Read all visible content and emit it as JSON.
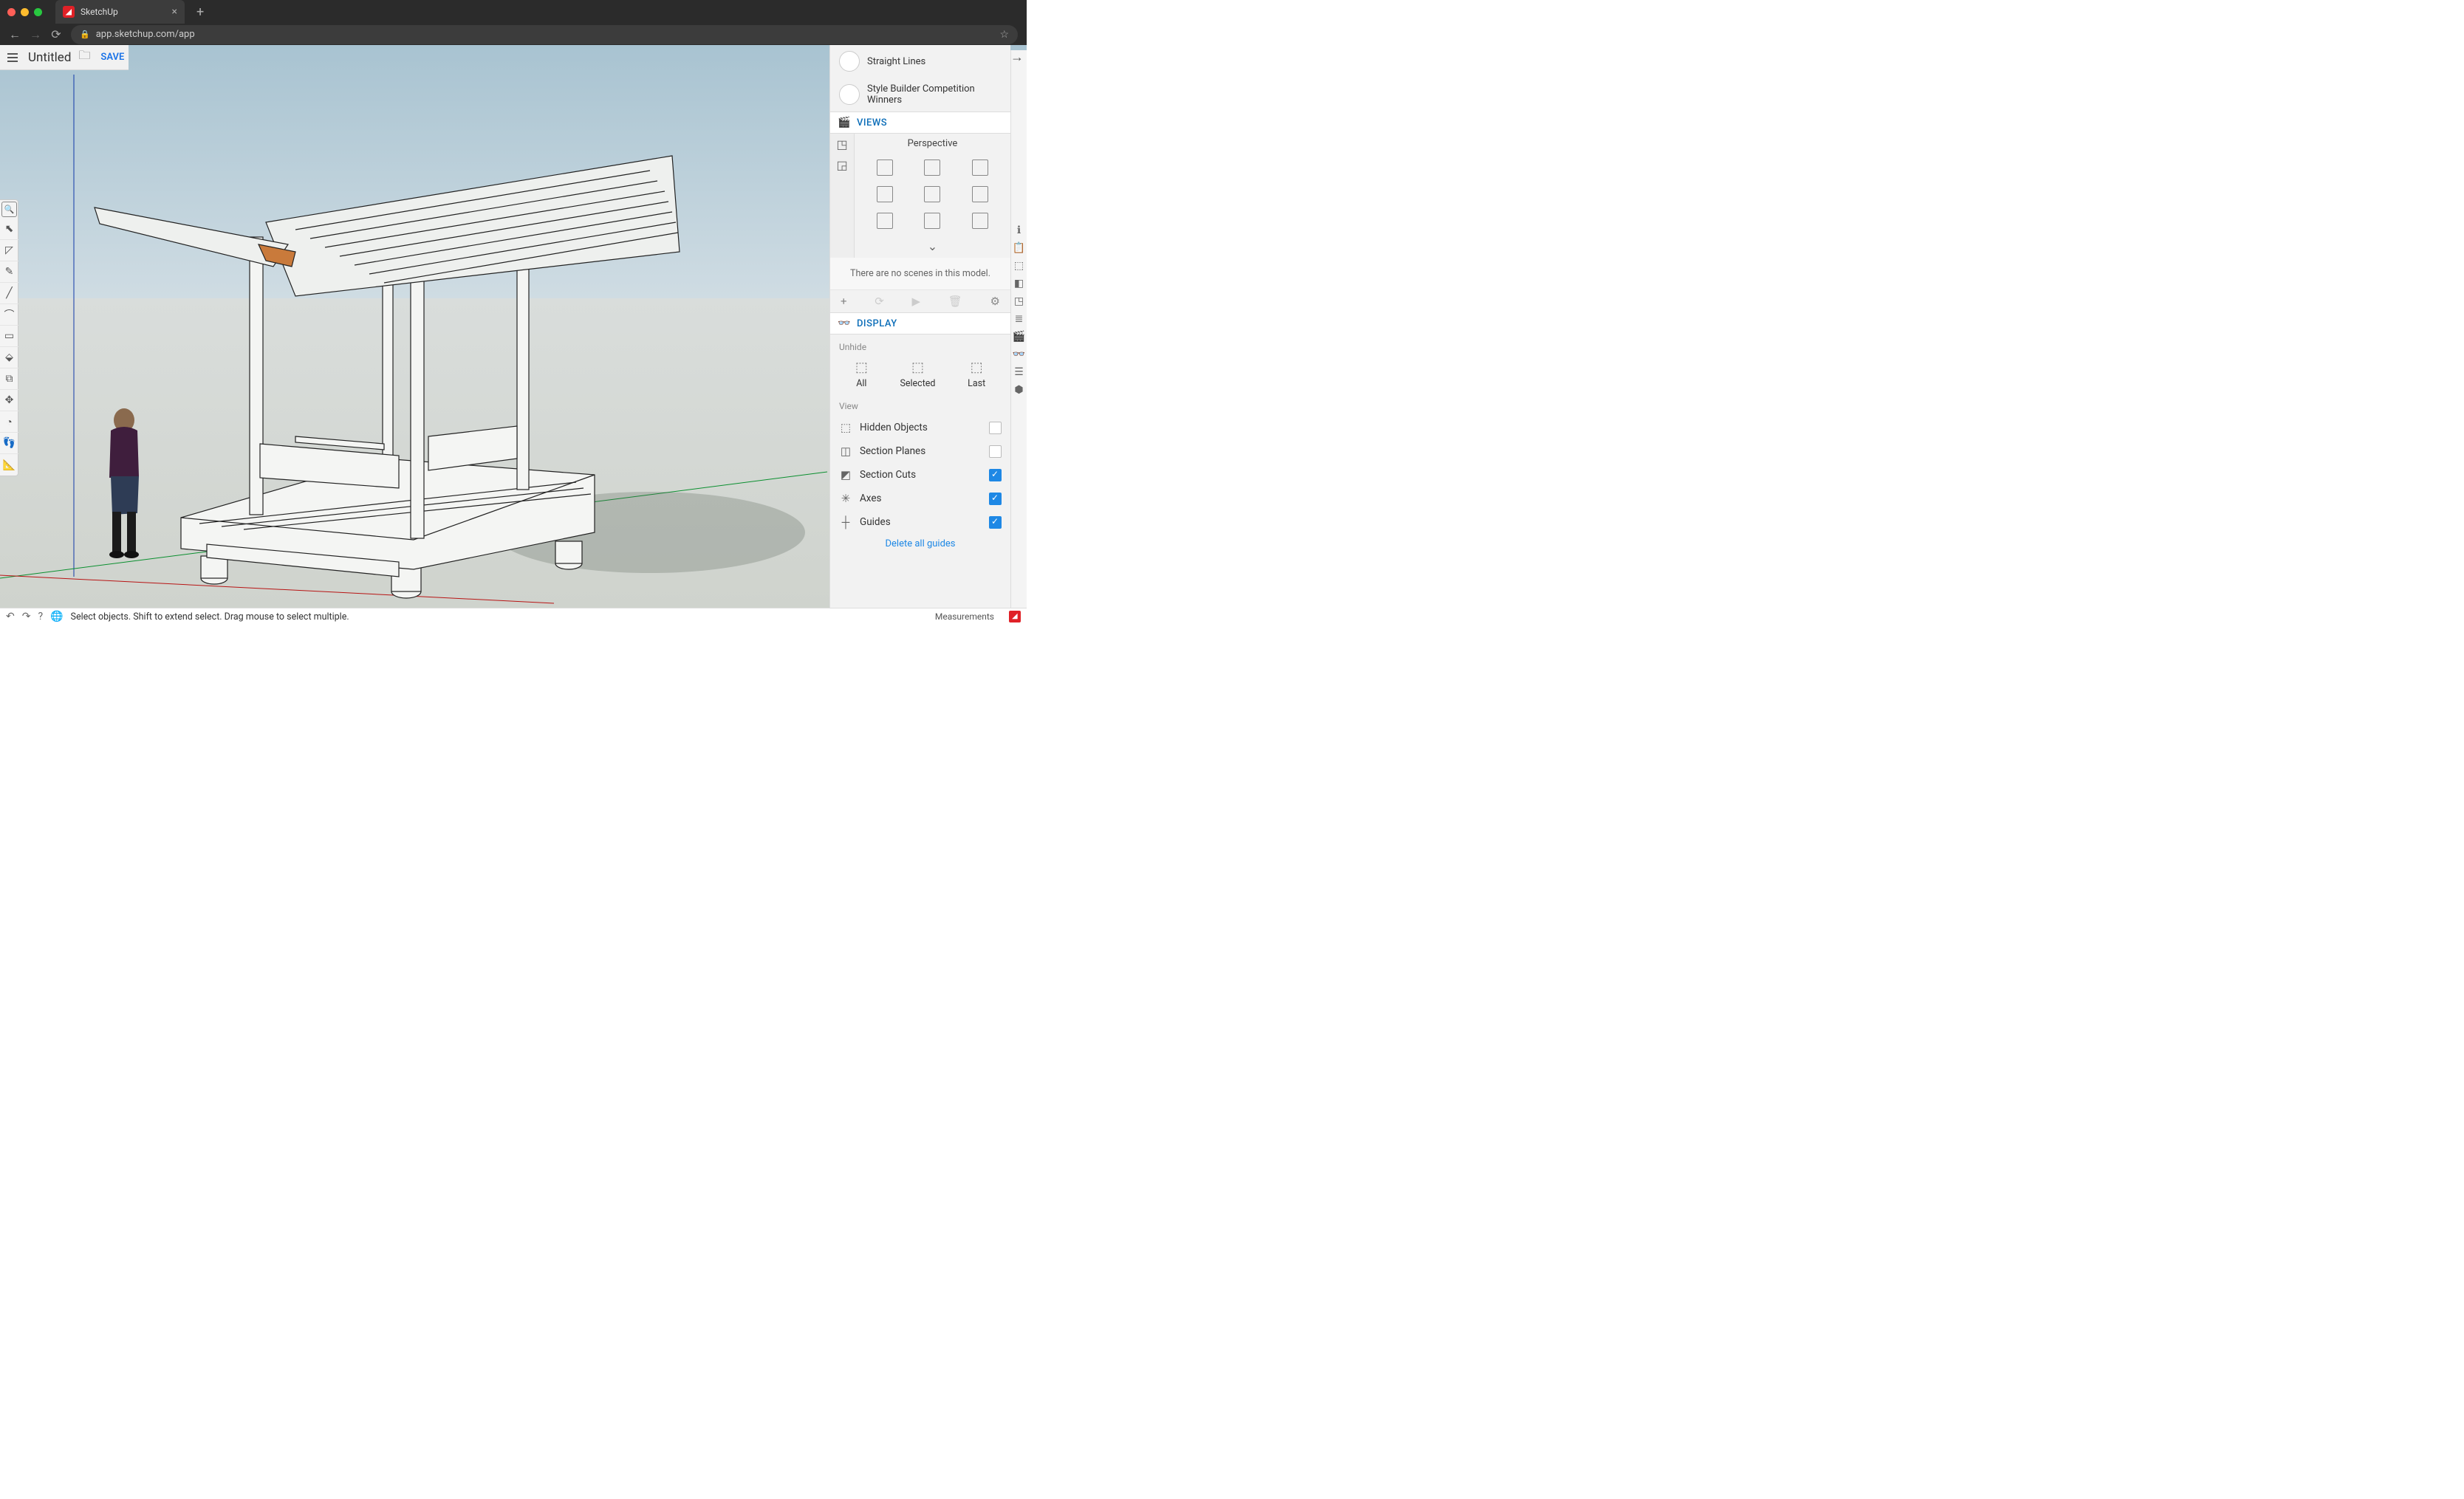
{
  "browser": {
    "tab_title": "SketchUp",
    "url": "app.sketchup.com/app"
  },
  "header": {
    "doc_title": "Untitled",
    "save_label": "SAVE"
  },
  "left_tools": [
    "🔍",
    "⬉",
    "⬚",
    "✎",
    "╱",
    "⌒",
    "▭",
    "◆",
    "⧉",
    "✥",
    "◔",
    "👣",
    "📐"
  ],
  "styles": [
    {
      "label": "Straight Lines"
    },
    {
      "label": "Style Builder Competition Winners"
    }
  ],
  "views": {
    "section_label": "VIEWS",
    "projection_label": "Perspective",
    "scene_note": "There are no scenes in this model."
  },
  "display": {
    "section_label": "DISPLAY",
    "unhide_label": "Unhide",
    "unhide_items": [
      "All",
      "Selected",
      "Last"
    ],
    "view_label": "View",
    "options": [
      {
        "label": "Hidden Objects",
        "checked": false
      },
      {
        "label": "Section Planes",
        "checked": false
      },
      {
        "label": "Section Cuts",
        "checked": true
      },
      {
        "label": "Axes",
        "checked": true
      },
      {
        "label": "Guides",
        "checked": true
      }
    ],
    "delete_guides": "Delete all guides"
  },
  "status": {
    "hint": "Select objects. Shift to extend select. Drag mouse to select multiple.",
    "measurements_label": "Measurements"
  }
}
